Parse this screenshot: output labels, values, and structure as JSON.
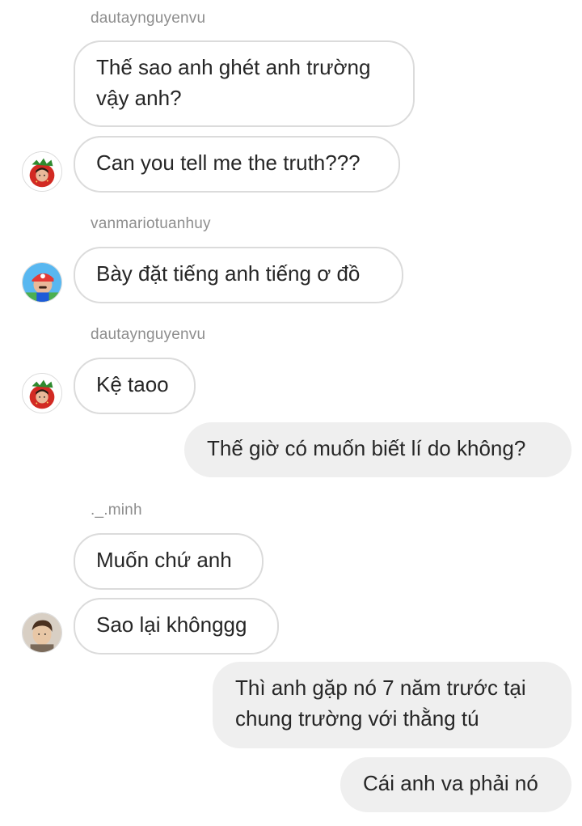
{
  "messages": [
    {
      "type": "sender",
      "text": "dautaynguyenvu"
    },
    {
      "type": "in",
      "text": "Thế sao anh ghét anh trường vậy anh?"
    },
    {
      "type": "in",
      "text": "Can you tell me the truth???"
    },
    {
      "type": "sender",
      "text": "vanmariotuanhuy"
    },
    {
      "type": "in",
      "text": "Bày đặt tiếng anh tiếng ơ đồ"
    },
    {
      "type": "sender",
      "text": "dautaynguyenvu"
    },
    {
      "type": "in",
      "text": "Kệ taoo"
    },
    {
      "type": "out",
      "text": "Thế giờ có muốn biết lí do không?"
    },
    {
      "type": "sender",
      "text": "._.minh"
    },
    {
      "type": "in",
      "text": "Muốn chứ anh"
    },
    {
      "type": "in",
      "text": "Sao lại khônggg"
    },
    {
      "type": "out",
      "text": "Thì anh gặp nó 7 năm trước tại chung trường với thằng tú"
    },
    {
      "type": "out",
      "text": "Cái anh va phải nó"
    }
  ],
  "avatars": [
    {
      "user": "dautaynguyenvu",
      "icon": "strawberry-avatar-icon"
    },
    {
      "user": "vanmariotuanhuy",
      "icon": "mario-avatar-icon"
    },
    {
      "user": "dautaynguyenvu",
      "icon": "strawberry-avatar-icon"
    },
    {
      "user": "._.minh",
      "icon": "photo-avatar-icon"
    }
  ]
}
